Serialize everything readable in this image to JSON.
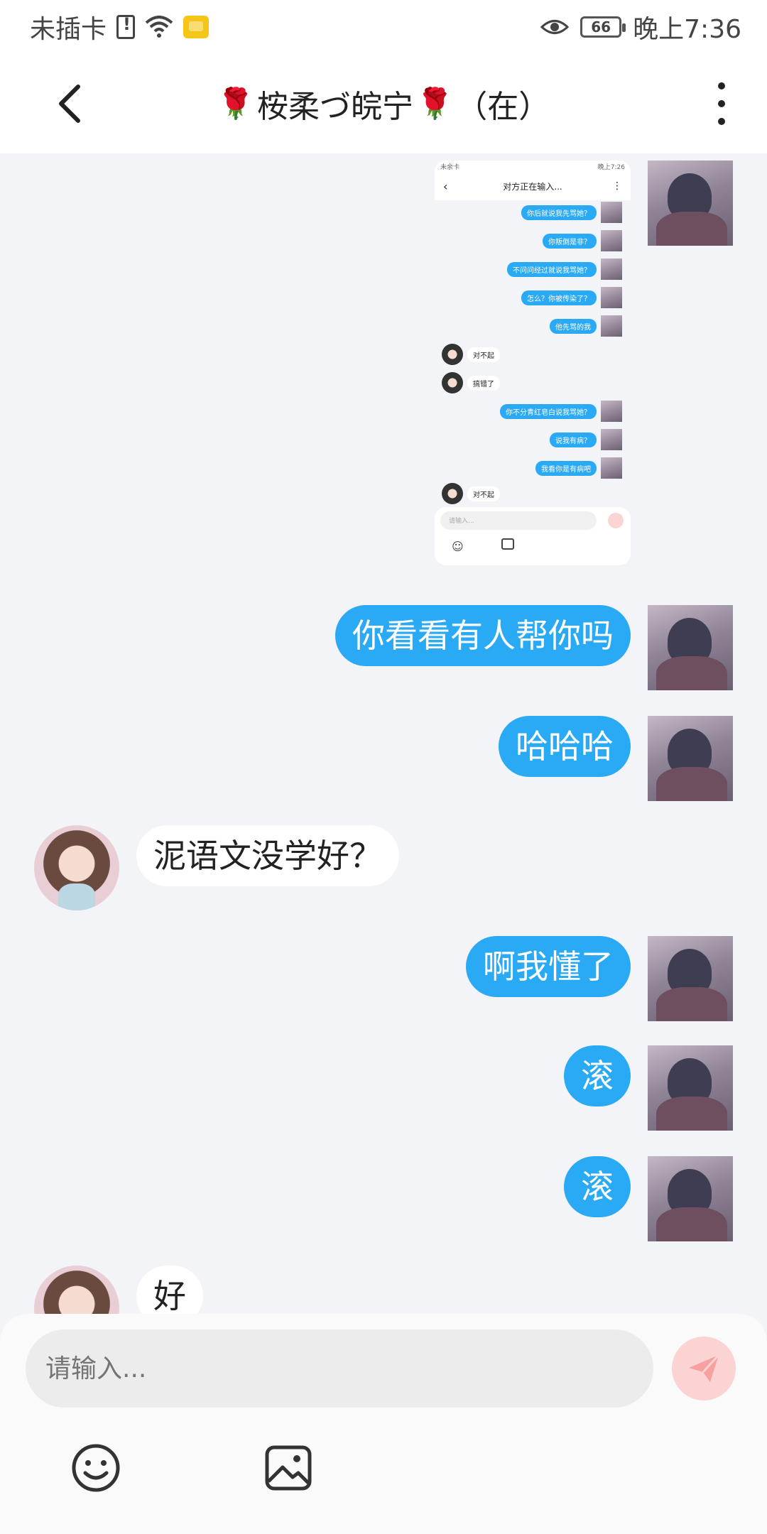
{
  "status_bar": {
    "carrier": "未插卡",
    "battery": "66",
    "time": "晚上7:36"
  },
  "header": {
    "back_icon": "chevron-left-icon",
    "title_name": "桉柔づ皖宁",
    "rose_emoji": "🌹",
    "title_status": "（在）",
    "menu_icon": "more-vertical-icon"
  },
  "messages": [
    {
      "side": "me",
      "type": "image",
      "content": "screenshot-image"
    },
    {
      "side": "me",
      "text": "你看看有人帮你吗"
    },
    {
      "side": "me",
      "text": "哈哈哈"
    },
    {
      "side": "her",
      "text": "泥语文没学好？"
    },
    {
      "side": "me",
      "text": "啊我懂了"
    },
    {
      "side": "me",
      "text": "滚"
    },
    {
      "side": "me",
      "text": "滚"
    },
    {
      "side": "her",
      "text": "好"
    }
  ],
  "screenshot": {
    "status_left": "未余卡",
    "status_right": "晚上7:26",
    "title": "对方正在输入...",
    "rows": [
      {
        "side": "me",
        "text": "你后就说我先骂她？"
      },
      {
        "side": "me",
        "text": "你叛倒是非？"
      },
      {
        "side": "me",
        "text": "不问问经过就说我骂她？"
      },
      {
        "side": "me",
        "text": "怎么？你被传染了？"
      },
      {
        "side": "me",
        "text": "他先骂的我"
      },
      {
        "side": "her",
        "text": "对不起"
      },
      {
        "side": "her",
        "text": "搞错了"
      },
      {
        "side": "me",
        "text": "你不分青红皂白说我骂她？"
      },
      {
        "side": "me",
        "text": "说我有病？"
      },
      {
        "side": "me",
        "text": "我看你是有病吧"
      },
      {
        "side": "her",
        "text": "对不起"
      }
    ],
    "input_placeholder": "请输入..."
  },
  "input_bar": {
    "placeholder": "请输入...",
    "send_icon": "send-icon",
    "emoji_icon": "smile-icon",
    "image_icon": "image-icon"
  },
  "colors": {
    "my_bubble": "#2aaaf4",
    "send_button": "#fbd3d3",
    "background": "#f3f4f8"
  }
}
